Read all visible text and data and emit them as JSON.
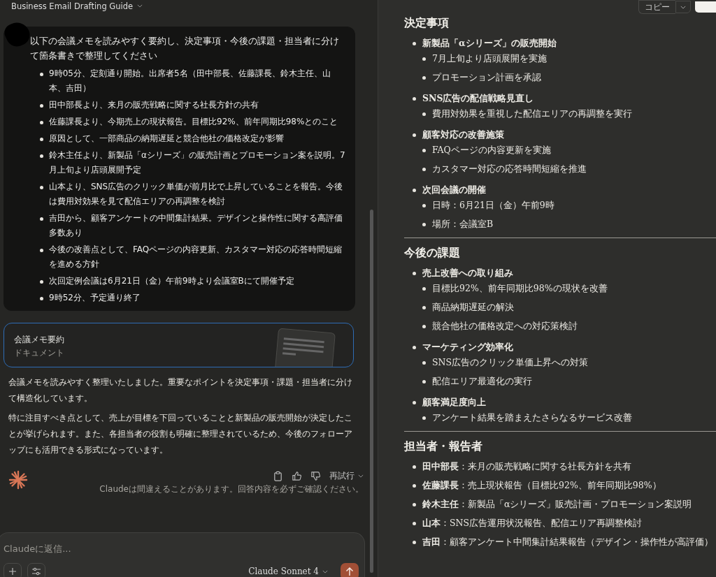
{
  "header": {
    "title": "Business Email Drafting Guide"
  },
  "user_message": {
    "intro": "以下の会議メモを読みやすく要約し、決定事項・今後の課題・担当者に分けて箇条書きで整理してください",
    "bullets": [
      "9時05分、定刻通り開始。出席者5名（田中部長、佐藤課長、鈴木主任、山本、吉田）",
      "田中部長より、来月の販売戦略に関する社長方針の共有",
      "佐藤課長より、今期売上の現状報告。目標比92%、前年同期比98%とのこと",
      "原因として、一部商品の納期遅延と競合他社の価格改定が影響",
      "鈴木主任より、新製品「αシリーズ」の販売計画とプロモーション案を説明。7月上旬より店頭展開予定",
      "山本より、SNS広告のクリック単価が前月比で上昇していることを報告。今後は費用対効果を見て配信エリアの再調整を検討",
      "吉田から、顧客アンケートの中間集計結果。デザインと操作性に関する高評価多数あり",
      "今後の改善点として、FAQページの内容更新、カスタマー対応の応答時間短縮を進める方針",
      "次回定例会議は6月21日（金）午前9時より会議室Bにて開催予定",
      "9時52分、予定通り終了"
    ]
  },
  "artifact_card": {
    "title": "会議メモ要約",
    "type": "ドキュメント"
  },
  "response": {
    "paragraphs": [
      "会議メモを読みやすく整理いたしました。重要なポイントを決定事項・課題・担当者に分けて構造化しています。",
      "特に注目すべき点として、売上が目標を下回っていることと新製品の販売開始が決定したことが挙げられます。また、各担当者の役割も明確に整理されているため、今後のフォローアップにも活用できる形式になっています。"
    ]
  },
  "message_actions": {
    "retry": "再試行",
    "disclaimer": "Claudeは間違えることがあります。回答内容を必ずご確認ください。"
  },
  "composer": {
    "placeholder": "Claudeに返信...",
    "model": "Claude Sonnet 4"
  },
  "artifact_panel": {
    "copy_button": "コピー",
    "sections": [
      {
        "heading": "決定事項",
        "items": [
          {
            "text": "新製品「αシリーズ」の販売開始",
            "children": [
              {
                "text": "7月上旬より店頭展開を実施"
              },
              {
                "text": "プロモーション計画を承認"
              }
            ]
          },
          {
            "text": "SNS広告の配信戦略見直し",
            "children": [
              {
                "text": "費用対効果を重視した配信エリアの再調整を実行"
              }
            ]
          },
          {
            "text": "顧客対応の改善施策",
            "children": [
              {
                "text": "FAQページの内容更新を実施"
              },
              {
                "text": "カスタマー対応の応答時間短縮を推進"
              }
            ]
          },
          {
            "text": "次回会議の開催",
            "children": [
              {
                "text": "日時：6月21日（金）午前9時"
              },
              {
                "text": "場所：会議室B"
              }
            ]
          }
        ]
      },
      {
        "heading": "今後の課題",
        "items": [
          {
            "text": "売上改善への取り組み",
            "children": [
              {
                "text": "目標比92%、前年同期比98%の現状を改善"
              },
              {
                "text": "商品納期遅延の解決"
              },
              {
                "text": "競合他社の価格改定への対応策検討"
              }
            ]
          },
          {
            "text": "マーケティング効率化",
            "children": [
              {
                "text": "SNS広告のクリック単価上昇への対策"
              },
              {
                "text": "配信エリア最適化の実行"
              }
            ]
          },
          {
            "text": "顧客満足度向上",
            "children": [
              {
                "text": "アンケート結果を踏まえたさらなるサービス改善"
              }
            ]
          }
        ]
      },
      {
        "heading": "担当者・報告者",
        "items": [
          {
            "text": "**田中部長**：来月の販売戦略に関する社長方針を共有"
          },
          {
            "text": "**佐藤課長**：売上現状報告（目標比92%、前年同期比98%）"
          },
          {
            "text": "**鈴木主任**：新製品「αシリーズ」販売計画・プロモーション案説明"
          },
          {
            "text": "**山本**：SNS広告運用状況報告、配信エリア再調整検討"
          },
          {
            "text": "**吉田**：顧客アンケート中間集計結果報告（デザイン・操作性が高評価）"
          }
        ]
      }
    ]
  }
}
